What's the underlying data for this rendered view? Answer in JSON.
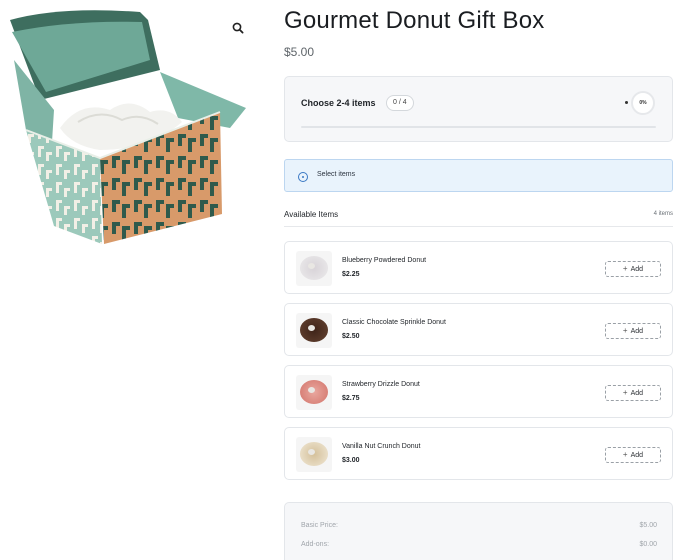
{
  "product": {
    "title": "Gourmet Donut Gift Box",
    "price": "$5.00"
  },
  "gallery": {
    "image_subject": "open teal and orange patterned gift box with white tissue paper",
    "zoom_icon": "magnifier-icon"
  },
  "selection": {
    "label": "Choose 2-4 items",
    "count": "0 / 4",
    "percent": "0%",
    "progress": 0
  },
  "notice": {
    "icon": "info-circle-icon",
    "text": "Select items"
  },
  "available": {
    "title": "Available Items",
    "count": "4 items",
    "items": [
      {
        "name": "Blueberry Powdered Donut",
        "price": "$2.25",
        "add_label": "Add",
        "donut_color": "#e6e4e6",
        "glaze": "#d8d3d8"
      },
      {
        "name": "Classic Chocolate Sprinkle Donut",
        "price": "$2.50",
        "add_label": "Add",
        "donut_color": "#5a3a2a",
        "glaze": "#3f2419"
      },
      {
        "name": "Strawberry Drizzle Donut",
        "price": "$2.75",
        "add_label": "Add",
        "donut_color": "#d9837a",
        "glaze": "#e9a89f"
      },
      {
        "name": "Vanilla Nut Crunch Donut",
        "price": "$3.00",
        "add_label": "Add",
        "donut_color": "#e8dcc4",
        "glaze": "#d4c09a"
      }
    ]
  },
  "pricing": {
    "rows": [
      {
        "label": "Basic Price:",
        "value": "$5.00"
      },
      {
        "label": "Add-ons:",
        "value": "$0.00"
      }
    ]
  },
  "colors": {
    "accent": "#2f7cd1",
    "info_bg": "#e9f3fc",
    "box_teal": "#2f5a4c",
    "box_mint": "#8cc0b1",
    "box_orange": "#d99a6c"
  }
}
